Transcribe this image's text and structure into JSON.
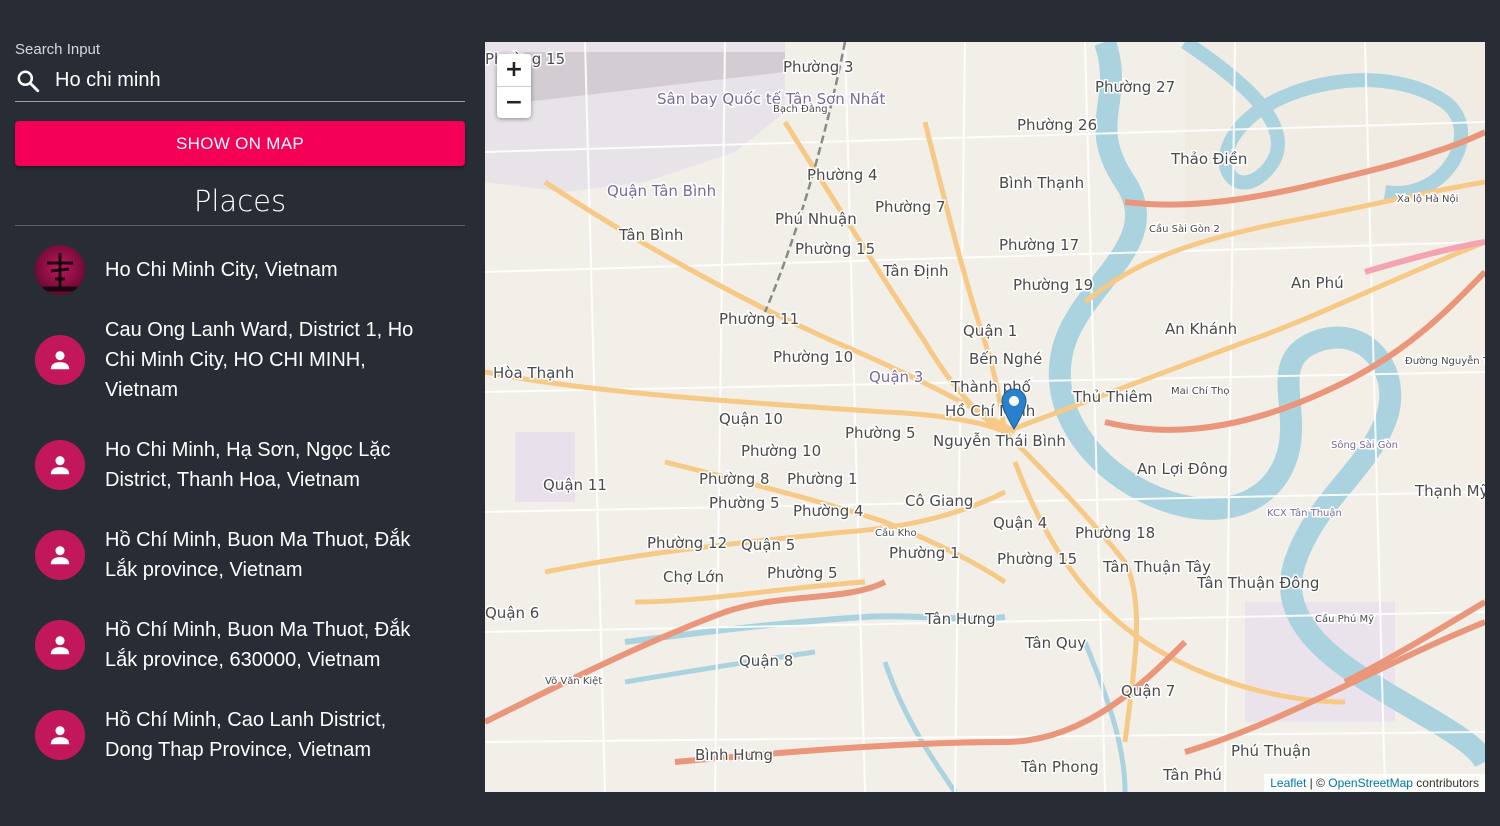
{
  "search": {
    "label": "Search Input",
    "value": "Ho chi minh"
  },
  "show_button": "SHOW ON MAP",
  "places_title": "Places",
  "places": [
    {
      "text": "Ho Chi Minh City, Vietnam",
      "avatar": "photo"
    },
    {
      "text": "Cau Ong Lanh Ward, District 1, Ho Chi Minh City, HO CHI MINH, Vietnam",
      "avatar": "person-icon"
    },
    {
      "text": "Ho Chi Minh, Hạ Sơn, Ngọc Lặc District, Thanh Hoa, Vietnam",
      "avatar": "person-icon"
    },
    {
      "text": "Hồ Chí Minh, Buon Ma Thuot, Đắk Lắk province, Vietnam",
      "avatar": "person-icon"
    },
    {
      "text": "Hồ Chí Minh, Buon Ma Thuot, Đắk Lắk province, 630000, Vietnam",
      "avatar": "person-icon"
    },
    {
      "text": "Hồ Chí Minh, Cao Lanh District, Dong Thap Province, Vietnam",
      "avatar": "person-icon"
    }
  ],
  "map": {
    "zoom_in": "+",
    "zoom_out": "−",
    "attribution": {
      "leaflet": "Leaflet",
      "separator": " | © ",
      "osm": "OpenStreetMap",
      "suffix": " contributors"
    },
    "labels": [
      "Phường 15",
      "Phường 3",
      "Phường 27",
      "Sân bay Quốc tế Tân Sơn Nhất",
      "Bạch Đằng",
      "Phường 26",
      "Phường 4",
      "Bình Thạnh",
      "Thảo Điền",
      "Quận Tân Bình",
      "Tân Bình",
      "Phú Nhuận",
      "Phường 7",
      "Phường 15",
      "Tân Định",
      "Phường 17",
      "Phường 19",
      "An Phú",
      "Phường 11",
      "Quận 1",
      "An Khánh",
      "Phường 10",
      "Bến Nghé",
      "Hòa Thạnh",
      "Quận 3",
      "Thành phố",
      "Hồ Chí Minh",
      "Thủ Thiêm",
      "Quận 10",
      "Phường 5",
      "Nguyễn Thái Bình",
      "Phường 10",
      "An Lợi Đông",
      "Quận 11",
      "Phường 8",
      "Phường 1",
      "Phường 5",
      "Phường 4",
      "Cô Giang",
      "Thạnh Mỹ",
      "Quận 4",
      "Phường 12",
      "Quận 5",
      "Cầu Kho",
      "Phường 18",
      "Phường 1",
      "Phường 15",
      "Tân Thuận Tây",
      "Chợ Lớn",
      "Phường 5",
      "Tân Thuận Đông",
      "Quận 6",
      "Tân Hưng",
      "Tân Quy",
      "Quận 8",
      "Quận 7",
      "Bình Hưng",
      "Phú Thuận",
      "Tân Phong",
      "Tân Phú",
      "Sông Sài Gòn",
      "KCX Tân Thuận",
      "Xa lộ Hà Nội",
      "Cầu Sài Gòn 2",
      "Mai Chí Thọ",
      "Đường Nguyễn Thị Định",
      "Võ Văn Kiệt",
      "Cầu Phú Mỹ"
    ]
  },
  "colors": {
    "accent": "#f50057",
    "avatar": "#c2185b",
    "background": "#282c34",
    "water": "#aad3df",
    "marker": "#2a81cb"
  }
}
